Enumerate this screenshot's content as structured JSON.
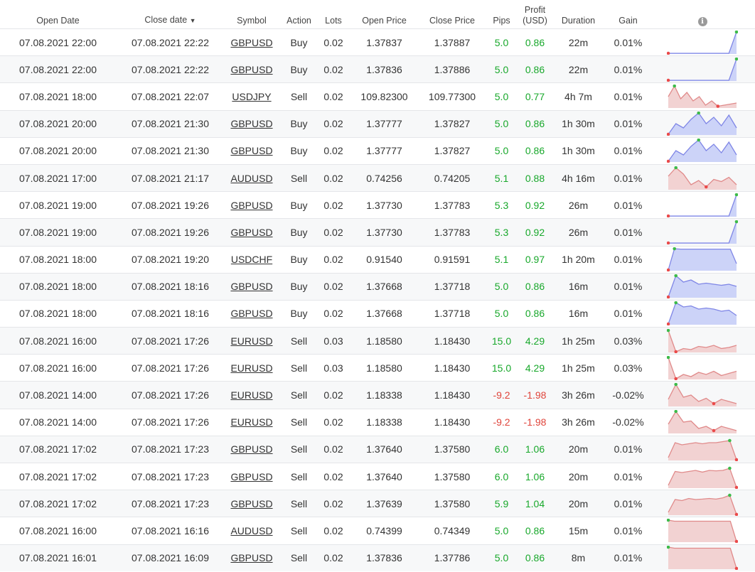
{
  "headers": {
    "open_date": "Open Date",
    "close_date": "Close date",
    "sort_arrow": "▼",
    "symbol": "Symbol",
    "action": "Action",
    "lots": "Lots",
    "open_price": "Open Price",
    "close_price": "Close Price",
    "pips": "Pips",
    "profit_line1": "Profit",
    "profit_line2": "(USD)",
    "duration": "Duration",
    "gain": "Gain",
    "info_icon": "i"
  },
  "colors": {
    "positive": "#18a82b",
    "negative": "#e0443b",
    "buy_line": "#7f86e6",
    "buy_fill": "#ccd3f8",
    "sell_line": "#e08a8a",
    "sell_fill": "#f2d2d2",
    "start_dot": "#ea4a4a",
    "peak_dot": "#3dbb4a"
  },
  "rows": [
    {
      "open": "07.08.2021 22:00",
      "close": "07.08.2021 22:22",
      "symbol": "GBPUSD",
      "action": "Buy",
      "lots": "0.02",
      "open_price": "1.37837",
      "close_price": "1.37887",
      "pips": "5.0",
      "profit": "0.86",
      "duration": "22m",
      "gain": "0.01%",
      "positive": true,
      "spark": [
        0,
        0,
        0,
        0,
        0,
        0,
        0,
        0,
        0,
        1
      ]
    },
    {
      "open": "07.08.2021 22:00",
      "close": "07.08.2021 22:22",
      "symbol": "GBPUSD",
      "action": "Buy",
      "lots": "0.02",
      "open_price": "1.37836",
      "close_price": "1.37886",
      "pips": "5.0",
      "profit": "0.86",
      "duration": "22m",
      "gain": "0.01%",
      "positive": true,
      "spark": [
        0,
        0,
        0,
        0,
        0,
        0,
        0,
        0,
        0,
        1
      ]
    },
    {
      "open": "07.08.2021 18:00",
      "close": "07.08.2021 22:07",
      "symbol": "USDJPY",
      "action": "Sell",
      "lots": "0.02",
      "open_price": "109.82300",
      "close_price": "109.77300",
      "pips": "5.0",
      "profit": "0.77",
      "duration": "4h 7m",
      "gain": "0.01%",
      "positive": true,
      "spark": [
        0.5,
        1,
        0.4,
        0.7,
        0.3,
        0.5,
        0.1,
        0.3,
        0.05,
        0.1,
        0.15,
        0.2
      ]
    },
    {
      "open": "07.08.2021 20:00",
      "close": "07.08.2021 21:30",
      "symbol": "GBPUSD",
      "action": "Buy",
      "lots": "0.02",
      "open_price": "1.37777",
      "close_price": "1.37827",
      "pips": "5.0",
      "profit": "0.86",
      "duration": "1h 30m",
      "gain": "0.01%",
      "positive": true,
      "spark": [
        0,
        0.5,
        0.3,
        0.7,
        1,
        0.5,
        0.8,
        0.4,
        0.9,
        0.3
      ]
    },
    {
      "open": "07.08.2021 20:00",
      "close": "07.08.2021 21:30",
      "symbol": "GBPUSD",
      "action": "Buy",
      "lots": "0.02",
      "open_price": "1.37777",
      "close_price": "1.37827",
      "pips": "5.0",
      "profit": "0.86",
      "duration": "1h 30m",
      "gain": "0.01%",
      "positive": true,
      "spark": [
        0,
        0.5,
        0.3,
        0.7,
        1,
        0.5,
        0.8,
        0.4,
        0.9,
        0.3
      ]
    },
    {
      "open": "07.08.2021 17:00",
      "close": "07.08.2021 21:17",
      "symbol": "AUDUSD",
      "action": "Sell",
      "lots": "0.02",
      "open_price": "0.74256",
      "close_price": "0.74205",
      "pips": "5.1",
      "profit": "0.88",
      "duration": "4h 16m",
      "gain": "0.01%",
      "positive": true,
      "spark": [
        0.6,
        1,
        0.7,
        0.2,
        0.4,
        0.1,
        0.45,
        0.35,
        0.55,
        0.2
      ]
    },
    {
      "open": "07.08.2021 19:00",
      "close": "07.08.2021 19:26",
      "symbol": "GBPUSD",
      "action": "Buy",
      "lots": "0.02",
      "open_price": "1.37730",
      "close_price": "1.37783",
      "pips": "5.3",
      "profit": "0.92",
      "duration": "26m",
      "gain": "0.01%",
      "positive": true,
      "spark": [
        0,
        0,
        0,
        0,
        0,
        0,
        0,
        0,
        0,
        1
      ]
    },
    {
      "open": "07.08.2021 19:00",
      "close": "07.08.2021 19:26",
      "symbol": "GBPUSD",
      "action": "Buy",
      "lots": "0.02",
      "open_price": "1.37730",
      "close_price": "1.37783",
      "pips": "5.3",
      "profit": "0.92",
      "duration": "26m",
      "gain": "0.01%",
      "positive": true,
      "spark": [
        0,
        0,
        0,
        0,
        0,
        0,
        0,
        0,
        0,
        1
      ]
    },
    {
      "open": "07.08.2021 18:00",
      "close": "07.08.2021 19:20",
      "symbol": "USDCHF",
      "action": "Buy",
      "lots": "0.02",
      "open_price": "0.91540",
      "close_price": "0.91591",
      "pips": "5.1",
      "profit": "0.97",
      "duration": "1h 20m",
      "gain": "0.01%",
      "positive": true,
      "spark": [
        0,
        1,
        0.98,
        0.98,
        0.98,
        0.98,
        0.98,
        0.98,
        0.98,
        0.98,
        0.98,
        0.3
      ]
    },
    {
      "open": "07.08.2021 18:00",
      "close": "07.08.2021 18:16",
      "symbol": "GBPUSD",
      "action": "Buy",
      "lots": "0.02",
      "open_price": "1.37668",
      "close_price": "1.37718",
      "pips": "5.0",
      "profit": "0.86",
      "duration": "16m",
      "gain": "0.01%",
      "positive": true,
      "spark": [
        0,
        1,
        0.7,
        0.8,
        0.6,
        0.65,
        0.6,
        0.55,
        0.6,
        0.5
      ]
    },
    {
      "open": "07.08.2021 18:00",
      "close": "07.08.2021 18:16",
      "symbol": "GBPUSD",
      "action": "Buy",
      "lots": "0.02",
      "open_price": "1.37668",
      "close_price": "1.37718",
      "pips": "5.0",
      "profit": "0.86",
      "duration": "16m",
      "gain": "0.01%",
      "positive": true,
      "spark": [
        0,
        1,
        0.8,
        0.85,
        0.7,
        0.75,
        0.7,
        0.6,
        0.65,
        0.4
      ]
    },
    {
      "open": "07.08.2021 16:00",
      "close": "07.08.2021 17:26",
      "symbol": "EURUSD",
      "action": "Sell",
      "lots": "0.03",
      "open_price": "1.18580",
      "close_price": "1.18430",
      "pips": "15.0",
      "profit": "4.29",
      "duration": "1h 25m",
      "gain": "0.03%",
      "positive": true,
      "spark": [
        1,
        0,
        0.15,
        0.1,
        0.25,
        0.2,
        0.3,
        0.15,
        0.2,
        0.3
      ]
    },
    {
      "open": "07.08.2021 16:00",
      "close": "07.08.2021 17:26",
      "symbol": "EURUSD",
      "action": "Sell",
      "lots": "0.03",
      "open_price": "1.18580",
      "close_price": "1.18430",
      "pips": "15.0",
      "profit": "4.29",
      "duration": "1h 25m",
      "gain": "0.03%",
      "positive": true,
      "spark": [
        1,
        0,
        0.2,
        0.1,
        0.3,
        0.2,
        0.35,
        0.15,
        0.25,
        0.35
      ]
    },
    {
      "open": "07.08.2021 14:00",
      "close": "07.08.2021 17:26",
      "symbol": "EURUSD",
      "action": "Sell",
      "lots": "0.02",
      "open_price": "1.18338",
      "close_price": "1.18430",
      "pips": "-9.2",
      "profit": "-1.98",
      "duration": "3h 26m",
      "gain": "-0.02%",
      "positive": false,
      "spark": [
        0.3,
        1,
        0.4,
        0.5,
        0.2,
        0.35,
        0.1,
        0.3,
        0.2,
        0.1
      ]
    },
    {
      "open": "07.08.2021 14:00",
      "close": "07.08.2021 17:26",
      "symbol": "EURUSD",
      "action": "Sell",
      "lots": "0.02",
      "open_price": "1.18338",
      "close_price": "1.18430",
      "pips": "-9.2",
      "profit": "-1.98",
      "duration": "3h 26m",
      "gain": "-0.02%",
      "positive": false,
      "spark": [
        0.4,
        1,
        0.5,
        0.55,
        0.2,
        0.3,
        0.1,
        0.3,
        0.2,
        0.1
      ]
    },
    {
      "open": "07.08.2021 17:02",
      "close": "07.08.2021 17:23",
      "symbol": "GBPUSD",
      "action": "Sell",
      "lots": "0.02",
      "open_price": "1.37640",
      "close_price": "1.37580",
      "pips": "6.0",
      "profit": "1.06",
      "duration": "20m",
      "gain": "0.01%",
      "positive": true,
      "spark": [
        0.1,
        0.8,
        0.7,
        0.75,
        0.8,
        0.75,
        0.8,
        0.8,
        0.85,
        0.9,
        0
      ]
    },
    {
      "open": "07.08.2021 17:02",
      "close": "07.08.2021 17:23",
      "symbol": "GBPUSD",
      "action": "Sell",
      "lots": "0.02",
      "open_price": "1.37640",
      "close_price": "1.37580",
      "pips": "6.0",
      "profit": "1.06",
      "duration": "20m",
      "gain": "0.01%",
      "positive": true,
      "spark": [
        0.1,
        0.75,
        0.7,
        0.75,
        0.8,
        0.72,
        0.8,
        0.78,
        0.8,
        0.9,
        0
      ]
    },
    {
      "open": "07.08.2021 17:02",
      "close": "07.08.2021 17:23",
      "symbol": "GBPUSD",
      "action": "Sell",
      "lots": "0.02",
      "open_price": "1.37639",
      "close_price": "1.37580",
      "pips": "5.9",
      "profit": "1.04",
      "duration": "20m",
      "gain": "0.01%",
      "positive": true,
      "spark": [
        0.1,
        0.7,
        0.65,
        0.75,
        0.7,
        0.72,
        0.75,
        0.72,
        0.78,
        0.9,
        0
      ]
    },
    {
      "open": "07.08.2021 16:00",
      "close": "07.08.2021 16:16",
      "symbol": "AUDUSD",
      "action": "Sell",
      "lots": "0.02",
      "open_price": "0.74399",
      "close_price": "0.74349",
      "pips": "5.0",
      "profit": "0.86",
      "duration": "15m",
      "gain": "0.01%",
      "positive": true,
      "spark": [
        1,
        0.95,
        0.95,
        0.95,
        0.95,
        0.95,
        0.95,
        0.95,
        0.95,
        0.95,
        0.95,
        0
      ]
    },
    {
      "open": "07.08.2021 16:01",
      "close": "07.08.2021 16:09",
      "symbol": "GBPUSD",
      "action": "Sell",
      "lots": "0.02",
      "open_price": "1.37836",
      "close_price": "1.37786",
      "pips": "5.0",
      "profit": "0.86",
      "duration": "8m",
      "gain": "0.01%",
      "positive": true,
      "spark": [
        1,
        0.95,
        0.95,
        0.95,
        0.95,
        0.95,
        0.95,
        0.95,
        0.95,
        0.95,
        0.95,
        0
      ]
    }
  ]
}
